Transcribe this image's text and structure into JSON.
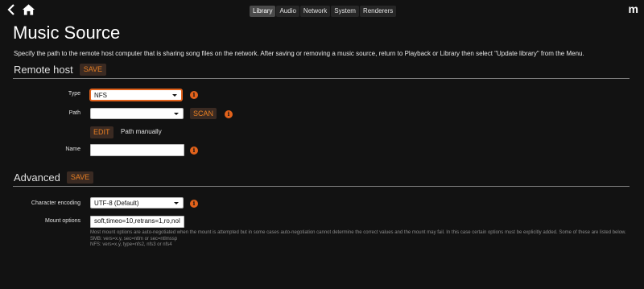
{
  "nav": {
    "tabs": [
      {
        "label": "Library",
        "active": true
      },
      {
        "label": "Audio",
        "active": false
      },
      {
        "label": "Network",
        "active": false
      },
      {
        "label": "System",
        "active": false
      },
      {
        "label": "Renderers",
        "active": false
      }
    ],
    "brand": "m"
  },
  "page": {
    "title": "Music Source",
    "description": "Specify the path to the remote host computer that is sharing song files on the network. After saving or removing a music source, return to Playback or Library then select \"Update library\" from the Menu."
  },
  "remote_host": {
    "heading": "Remote host",
    "save_label": "SAVE",
    "type_label": "Type",
    "type_value": "NFS",
    "path_label": "Path",
    "path_value": "",
    "scan_label": "SCAN",
    "edit_label": "EDIT",
    "manual_label": "Path manually",
    "name_label": "Name",
    "name_value": ""
  },
  "advanced": {
    "heading": "Advanced",
    "save_label": "SAVE",
    "encoding_label": "Character encoding",
    "encoding_value": "UTF-8 (Default)",
    "mount_label": "Mount options",
    "mount_value": "soft,timeo=10,retrans=1,ro,nol",
    "help_line1": "Most mount options are auto-negotiated when the mount is attempted but in some cases auto-negotiation cannot determine the correct values and the mount may fail. In this case certain options must be explicitly added. Some of these are listed below.",
    "help_line2": "SMB: vers=x.y, sec=ntlm or sec=ntlmssp",
    "help_line3": "NFS: vers=x.y, type=nfs2, nfs3 or nfs4"
  },
  "colors": {
    "accent": "#e2621b",
    "background": "#121212"
  },
  "icons": [
    "back-icon",
    "home-icon",
    "brand-icon",
    "info-icon",
    "chevron-down-icon"
  ]
}
